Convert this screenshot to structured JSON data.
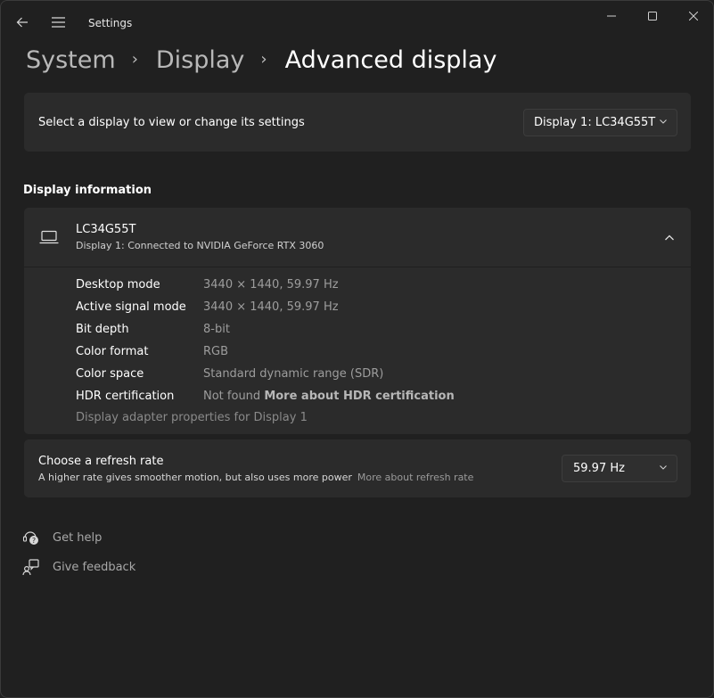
{
  "app": {
    "title": "Settings"
  },
  "breadcrumb": {
    "items": [
      "System",
      "Display",
      "Advanced display"
    ]
  },
  "display_select": {
    "label": "Select a display to view or change its settings",
    "selected": "Display 1: LC34G55T"
  },
  "display_info": {
    "section_title": "Display information",
    "name": "LC34G55T",
    "subtitle": "Display 1: Connected to NVIDIA GeForce RTX 3060",
    "properties": [
      {
        "name": "Desktop mode",
        "value": "3440 × 1440, 59.97 Hz"
      },
      {
        "name": "Active signal mode",
        "value": "3440 × 1440, 59.97 Hz"
      },
      {
        "name": "Bit depth",
        "value": "8-bit"
      },
      {
        "name": "Color format",
        "value": "RGB"
      },
      {
        "name": "Color space",
        "value": "Standard dynamic range (SDR)"
      },
      {
        "name": "HDR certification",
        "value": "Not found",
        "link": "More about HDR certification"
      }
    ],
    "adapter_link": "Display adapter properties for Display 1"
  },
  "refresh_rate": {
    "title": "Choose a refresh rate",
    "description": "A higher rate gives smoother motion, but also uses more power",
    "link": "More about refresh rate",
    "selected": "59.97 Hz"
  },
  "help": {
    "get_help": "Get help",
    "give_feedback": "Give feedback"
  },
  "icons": {
    "back": "back-arrow-icon",
    "menu": "hamburger-menu-icon",
    "minimize": "minimize-icon",
    "maximize": "maximize-icon",
    "close": "close-icon",
    "display": "laptop-icon",
    "collapse": "chevron-up-icon",
    "dropdown": "chevron-down-icon",
    "help": "help-icon",
    "feedback": "feedback-icon"
  }
}
